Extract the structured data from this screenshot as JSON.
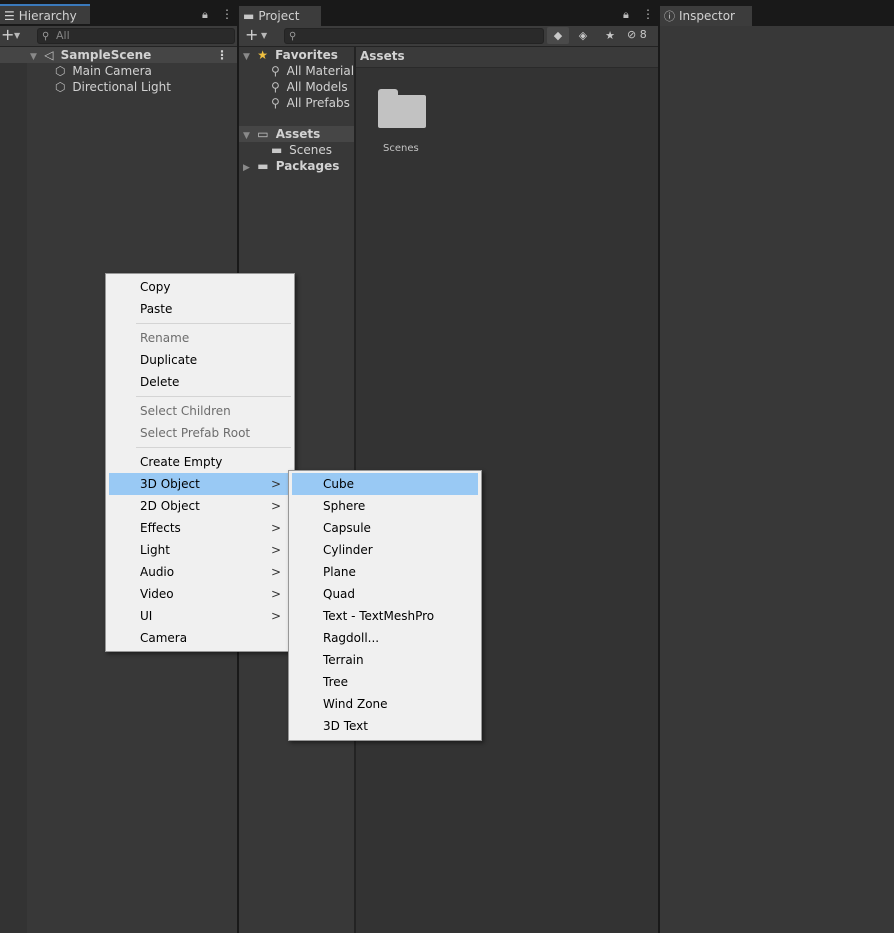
{
  "hierarchy": {
    "tab_label": "Hierarchy",
    "search_placeholder": "All",
    "scene": "SampleScene",
    "objects": [
      "Main Camera",
      "Directional Light"
    ]
  },
  "project": {
    "tab_label": "Project",
    "hidden_count": "8",
    "favorites_label": "Favorites",
    "favorites": [
      "All Materials",
      "All Models",
      "All Prefabs"
    ],
    "assets_label": "Assets",
    "assets_children": [
      "Scenes"
    ],
    "packages_label": "Packages",
    "breadcrumb": "Assets",
    "grid_items": [
      "Scenes"
    ]
  },
  "inspector": {
    "tab_label": "Inspector"
  },
  "context_menu": {
    "items": [
      {
        "label": "Copy"
      },
      {
        "label": "Paste"
      },
      {
        "label": "Rename"
      },
      {
        "label": "Duplicate"
      },
      {
        "label": "Delete"
      },
      {
        "label": "Select Children"
      },
      {
        "label": "Select Prefab Root"
      },
      {
        "label": "Create Empty"
      },
      {
        "label": "3D Object"
      },
      {
        "label": "2D Object"
      },
      {
        "label": "Effects"
      },
      {
        "label": "Light"
      },
      {
        "label": "Audio"
      },
      {
        "label": "Video"
      },
      {
        "label": "UI"
      },
      {
        "label": "Camera"
      }
    ],
    "arrow_glyph": ">"
  },
  "submenu": {
    "items": [
      "Cube",
      "Sphere",
      "Capsule",
      "Cylinder",
      "Plane",
      "Quad",
      "Text - TextMeshPro",
      "Ragdoll...",
      "Terrain",
      "Tree",
      "Wind Zone",
      "3D Text"
    ]
  },
  "colors": {
    "highlight": "#99c9f4",
    "panel_bg": "#383838",
    "tab_accent": "#3a79bb"
  }
}
